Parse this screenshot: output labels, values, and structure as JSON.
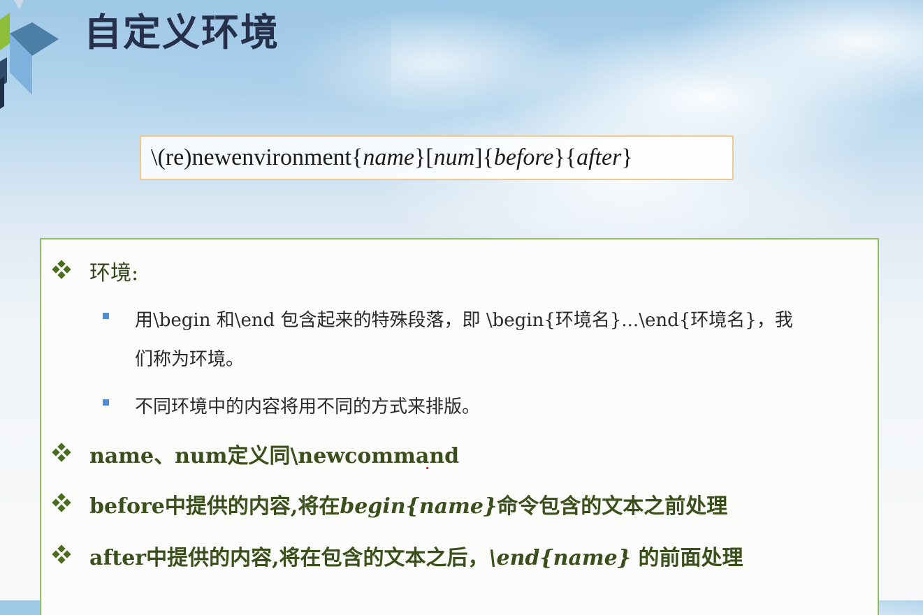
{
  "slide": {
    "title": "自定义环境",
    "syntax": {
      "prefix": "\\(re)newenvironment",
      "name": "name",
      "num": "num",
      "before": "before",
      "after": "after"
    },
    "bullets": {
      "env_heading": "环境:",
      "env_sub1_line1": "用\\begin 和\\end 包含起来的特殊段落，即 \\begin{环境名}...\\end{环境名}，我",
      "env_sub1_line2": "们称为环境。",
      "env_sub2": "不同环境中的内容将用不同的方式来排版。",
      "name_num": "name、num定义同\\newcommand",
      "before_pre": "before中提供的内容,将在",
      "before_cmd": "begin{name}",
      "before_post": "命令包含的文本之前处理",
      "after_pre": "after中提供的内容,将在包含的文本之后，",
      "after_cmd": "\\end{name}",
      "after_post": " 的前面处理"
    }
  },
  "colors": {
    "title": "#27304a",
    "bullet_text": "#3a4f1b",
    "diamond": "#4b6b1f",
    "square": "#4d8fd0",
    "box_border": "#8fc05a",
    "syntax_border": "#f1c98a"
  },
  "icons": {
    "bullet1": "diamond-bullet-icon",
    "bullet2": "square-bullet-icon",
    "logo": "cube-logo-icon"
  }
}
